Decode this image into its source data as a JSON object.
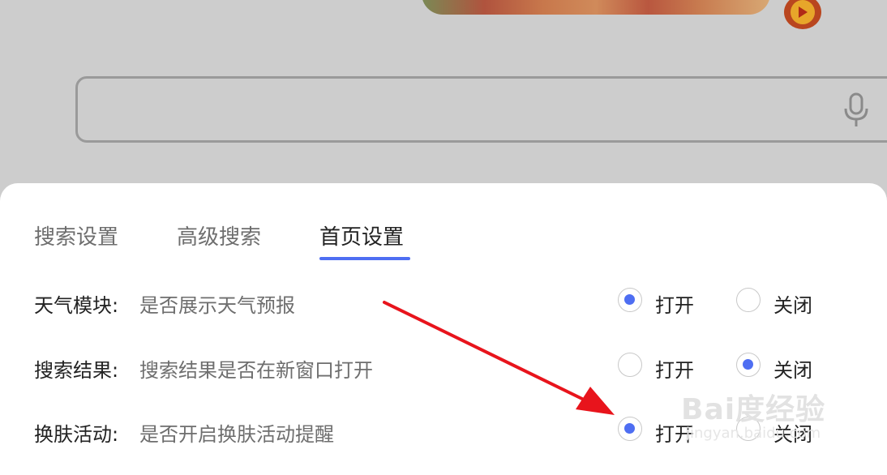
{
  "search": {
    "placeholder": ""
  },
  "tabs": [
    {
      "label": "搜索设置"
    },
    {
      "label": "高级搜索"
    },
    {
      "label": "首页设置",
      "active": true
    }
  ],
  "settings": [
    {
      "name": "天气模块:",
      "desc": "是否展示天气预报",
      "on_label": "打开",
      "off_label": "关闭",
      "selected": "on"
    },
    {
      "name": "搜索结果:",
      "desc": "搜索结果是否在新窗口打开",
      "on_label": "打开",
      "off_label": "关闭",
      "selected": "off"
    },
    {
      "name": "换肤活动:",
      "desc": "是否开启换肤活动提醒",
      "on_label": "打开",
      "off_label": "关闭",
      "selected": "on"
    }
  ],
  "watermark": {
    "main": "Bai度经验",
    "sub": "jingyan.baidu.com"
  },
  "colors": {
    "accent": "#4e6ef2",
    "annotation_arrow": "#e8141c"
  }
}
